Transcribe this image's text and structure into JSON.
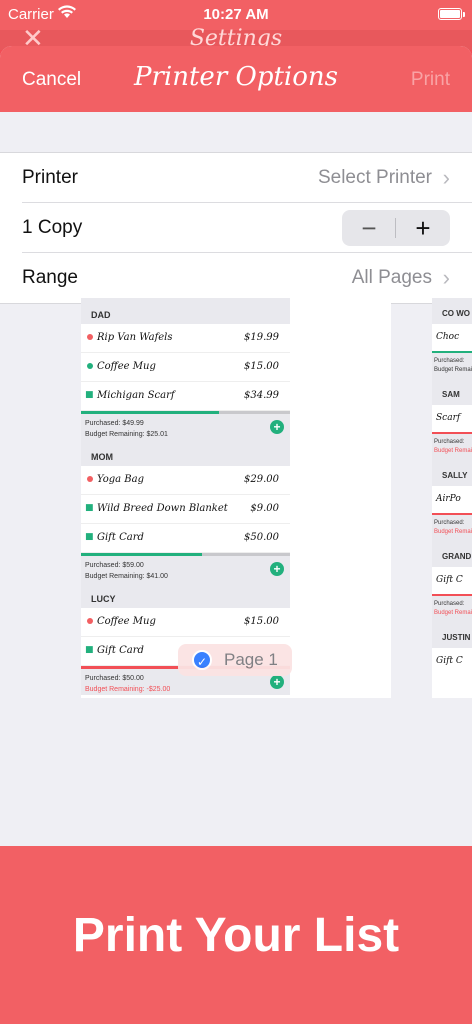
{
  "status_bar": {
    "carrier": "Carrier",
    "time": "10:27 AM"
  },
  "background_screen": {
    "title": "Settings",
    "close_symbol": "✕"
  },
  "nav": {
    "cancel": "Cancel",
    "title": "Printer Options",
    "print": "Print"
  },
  "options": {
    "printer_label": "Printer",
    "printer_value": "Select Printer",
    "copies_label": "1 Copy",
    "minus": "−",
    "plus": "+",
    "range_label": "Range",
    "range_value": "All Pages"
  },
  "preview": {
    "page_label": "Page 1",
    "sections": [
      {
        "name": "DAD",
        "items": [
          {
            "marker": "dot",
            "color": "#f25f62",
            "name": "Rip Van Wafels",
            "price": "$19.99"
          },
          {
            "marker": "dot",
            "color": "#22b07d",
            "name": "Coffee Mug",
            "price": "$15.00"
          },
          {
            "marker": "gift",
            "color": "#22b07d",
            "name": "Michigan Scarf",
            "price": "$34.99"
          }
        ],
        "purchased": "Purchased: $49.99",
        "remaining": "Budget Remaining: $25.01",
        "over": false,
        "progress": 0.66
      },
      {
        "name": "MOM",
        "items": [
          {
            "marker": "dot",
            "color": "#f25f62",
            "name": "Yoga Bag",
            "price": "$29.00"
          },
          {
            "marker": "gift",
            "color": "#22b07d",
            "name": "Wild Breed Down Blanket",
            "price": "$9.00"
          },
          {
            "marker": "gift",
            "color": "#22b07d",
            "name": "Gift Card",
            "price": "$50.00"
          }
        ],
        "purchased": "Purchased: $59.00",
        "remaining": "Budget Remaining: $41.00",
        "over": false,
        "progress": 0.58
      },
      {
        "name": "LUCY",
        "items": [
          {
            "marker": "dot",
            "color": "#f25f62",
            "name": "Coffee Mug",
            "price": "$15.00"
          },
          {
            "marker": "gift",
            "color": "#22b07d",
            "name": "Gift Card",
            "price": ""
          }
        ],
        "purchased": "Purchased: $50.00",
        "remaining": "Budget Remaining: -$25.00",
        "over": true,
        "progress": 1.0
      }
    ],
    "page2": {
      "sections": [
        {
          "name": "CO WO",
          "item": "Choc",
          "marker": "gift",
          "bar": "g",
          "purchased": "Purchased:",
          "remaining": "Budget Remaining:",
          "over": false
        },
        {
          "name": "SAM",
          "item": "Scarf",
          "marker": "gift",
          "bar": "r",
          "purchased": "Purchased:",
          "remaining": "Budget Remaining:",
          "over": true
        },
        {
          "name": "SALLY",
          "item": "AirPo",
          "marker": "gift",
          "bar": "r",
          "purchased": "Purchased:",
          "remaining": "Budget Remaining:",
          "over": true
        },
        {
          "name": "GRAND",
          "item": "Gift C",
          "marker": "dot",
          "bar": "r",
          "purchased": "Purchased:",
          "remaining": "Budget Remaining:",
          "over": true
        },
        {
          "name": "JUSTIN",
          "item": "Gift C",
          "marker": "dot",
          "bar": "",
          "purchased": "",
          "remaining": "",
          "over": false
        }
      ]
    }
  },
  "banner": {
    "text": "Print Your List"
  }
}
